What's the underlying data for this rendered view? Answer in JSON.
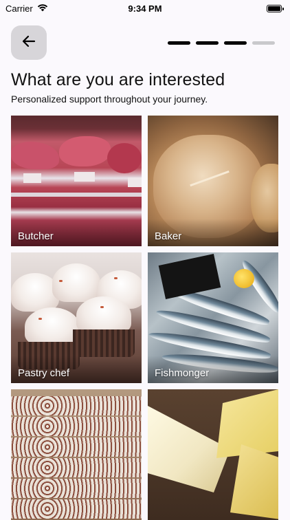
{
  "status_bar": {
    "carrier": "Carrier",
    "time": "9:34 PM",
    "wifi_icon": "wifi-icon",
    "battery_icon": "battery-icon"
  },
  "header": {
    "back_icon": "arrow-left-icon",
    "progress": {
      "total_steps": 4,
      "completed_steps": 3
    }
  },
  "title": "What are you are interested",
  "subtitle": "Personalized support throughout your journey.",
  "options": [
    {
      "label": "Butcher"
    },
    {
      "label": "Baker"
    },
    {
      "label": "Pastry chef"
    },
    {
      "label": "Fishmonger"
    },
    {
      "label": ""
    },
    {
      "label": ""
    }
  ],
  "colors": {
    "background": "#fbf9fd",
    "back_button_bg": "#d7d5d9",
    "progress_active": "#000000",
    "progress_inactive": "#c9c9cc"
  }
}
